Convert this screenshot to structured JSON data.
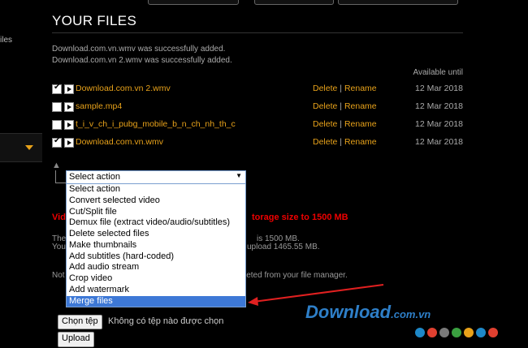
{
  "sidebar": {
    "text_fragment": "iles"
  },
  "header": {
    "title": "YOUR FILES"
  },
  "messages": [
    "Download.com.vn.wmv was successfully added.",
    "Download.com.vn 2.wmv was successfully added."
  ],
  "available_until_label": "Available until",
  "files": [
    {
      "name": "Download.com.vn 2.wmv",
      "checked": true,
      "delete": "Delete",
      "sep": "|",
      "rename": "Rename",
      "date": "12 Mar 2018"
    },
    {
      "name": "sample.mp4",
      "checked": false,
      "delete": "Delete",
      "sep": "|",
      "rename": "Rename",
      "date": "12 Mar 2018"
    },
    {
      "name": "t_i_v_ch_i_pubg_mobile_b_n_ch_nh_th_c",
      "checked": false,
      "delete": "Delete",
      "sep": "|",
      "rename": "Rename",
      "date": "12 Mar 2018"
    },
    {
      "name": "Download.com.vn.wmv",
      "checked": true,
      "delete": "Delete",
      "sep": "|",
      "rename": "Rename",
      "date": "12 Mar 2018"
    }
  ],
  "background_text": {
    "red_left": "Vid",
    "red_right": "torage size to 1500 MB",
    "line1_left": "The",
    "line1_right": "is 1500 MB.",
    "line2_left": "You",
    "line2_right": "upload 1465.55 MB.",
    "line3_left": "Not",
    "line3_right": "leted from your file manager."
  },
  "action_select": {
    "selected": "Select action",
    "options": [
      "Select action",
      "Convert selected video",
      "Cut/Split file",
      "Demux file (extract video/audio/subtitles)",
      "Delete selected files",
      "Make thumbnails",
      "Add subtitles (hard-coded)",
      "Add audio stream",
      "Crop video",
      "Add watermark",
      "Merge files"
    ],
    "highlighted": "Merge files"
  },
  "file_input": {
    "button_label": "Chọn tệp",
    "status": "Không có tệp nào được chọn"
  },
  "upload_button": "Upload",
  "watermark": {
    "text": "Download",
    "suffix": ".com.vn"
  },
  "colors": {
    "accent": "#e8a21a",
    "highlight": "#3d78d6",
    "alert": "#ee0000",
    "annotation_arrow": "#e02020"
  },
  "watermark_dots": [
    "#1e88c8",
    "#e04030",
    "#7a7a7a",
    "#3aa040",
    "#e8a21a",
    "#1e88c8",
    "#e04030"
  ]
}
